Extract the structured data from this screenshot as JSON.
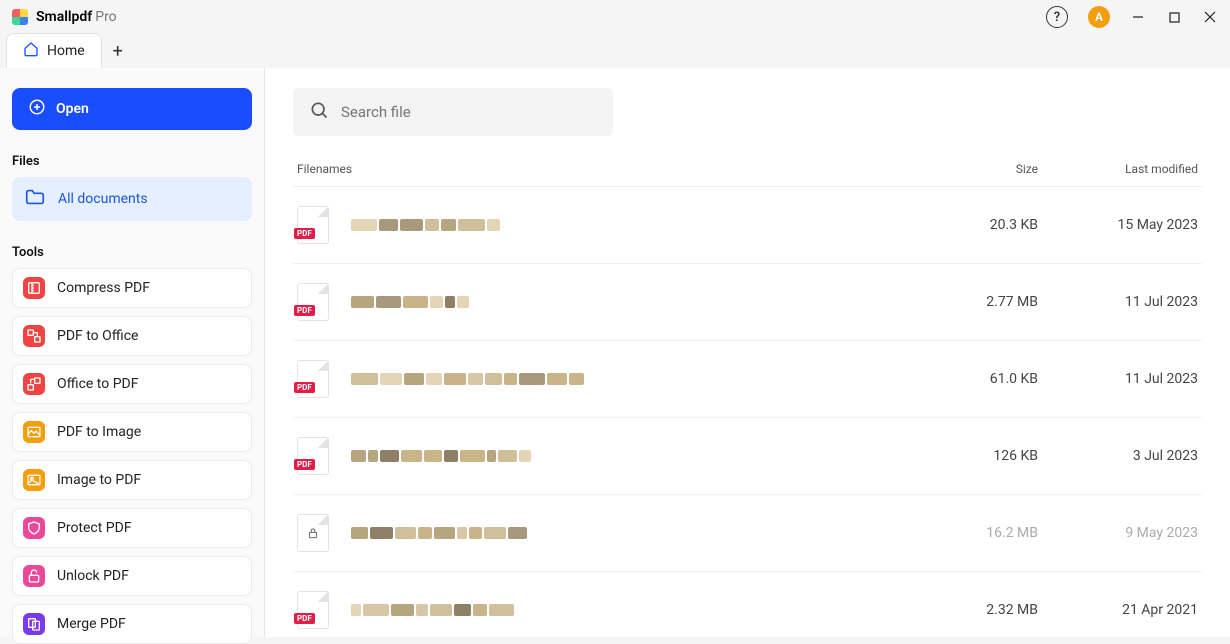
{
  "app": {
    "name": "Smallpdf",
    "suffix": "Pro",
    "avatar_initial": "A"
  },
  "tabs": {
    "home_label": "Home"
  },
  "sidebar": {
    "open_label": "Open",
    "files_heading": "Files",
    "all_documents": "All documents",
    "tools_heading": "Tools",
    "tools": [
      {
        "label": "Compress PDF",
        "icon": "compress-icon",
        "color": "red"
      },
      {
        "label": "PDF to Office",
        "icon": "pdf-to-office-icon",
        "color": "red"
      },
      {
        "label": "Office to PDF",
        "icon": "office-to-pdf-icon",
        "color": "red"
      },
      {
        "label": "PDF to Image",
        "icon": "pdf-to-image-icon",
        "color": "yellow"
      },
      {
        "label": "Image to PDF",
        "icon": "image-to-pdf-icon",
        "color": "yellow"
      },
      {
        "label": "Protect PDF",
        "icon": "protect-icon",
        "color": "pink"
      },
      {
        "label": "Unlock PDF",
        "icon": "unlock-icon",
        "color": "pink"
      },
      {
        "label": "Merge PDF",
        "icon": "merge-icon",
        "color": "purple"
      }
    ]
  },
  "search": {
    "placeholder": "Search file"
  },
  "table": {
    "columns": {
      "name": "Filenames",
      "size": "Size",
      "date": "Last modified"
    },
    "rows": [
      {
        "type": "pdf",
        "size": "20.3 KB",
        "date": "15 May 2023",
        "locked": false
      },
      {
        "type": "pdf",
        "size": "2.77 MB",
        "date": "11 Jul 2023",
        "locked": false
      },
      {
        "type": "pdf",
        "size": "61.0 KB",
        "date": "11 Jul 2023",
        "locked": false
      },
      {
        "type": "pdf",
        "size": "126 KB",
        "date": "3 Jul 2023",
        "locked": false
      },
      {
        "type": "pdf",
        "size": "16.2 MB",
        "date": "9 May 2023",
        "locked": true
      },
      {
        "type": "pdf",
        "size": "2.32 MB",
        "date": "21 Apr 2021",
        "locked": false
      }
    ]
  },
  "badges": {
    "pdf": "PDF"
  }
}
